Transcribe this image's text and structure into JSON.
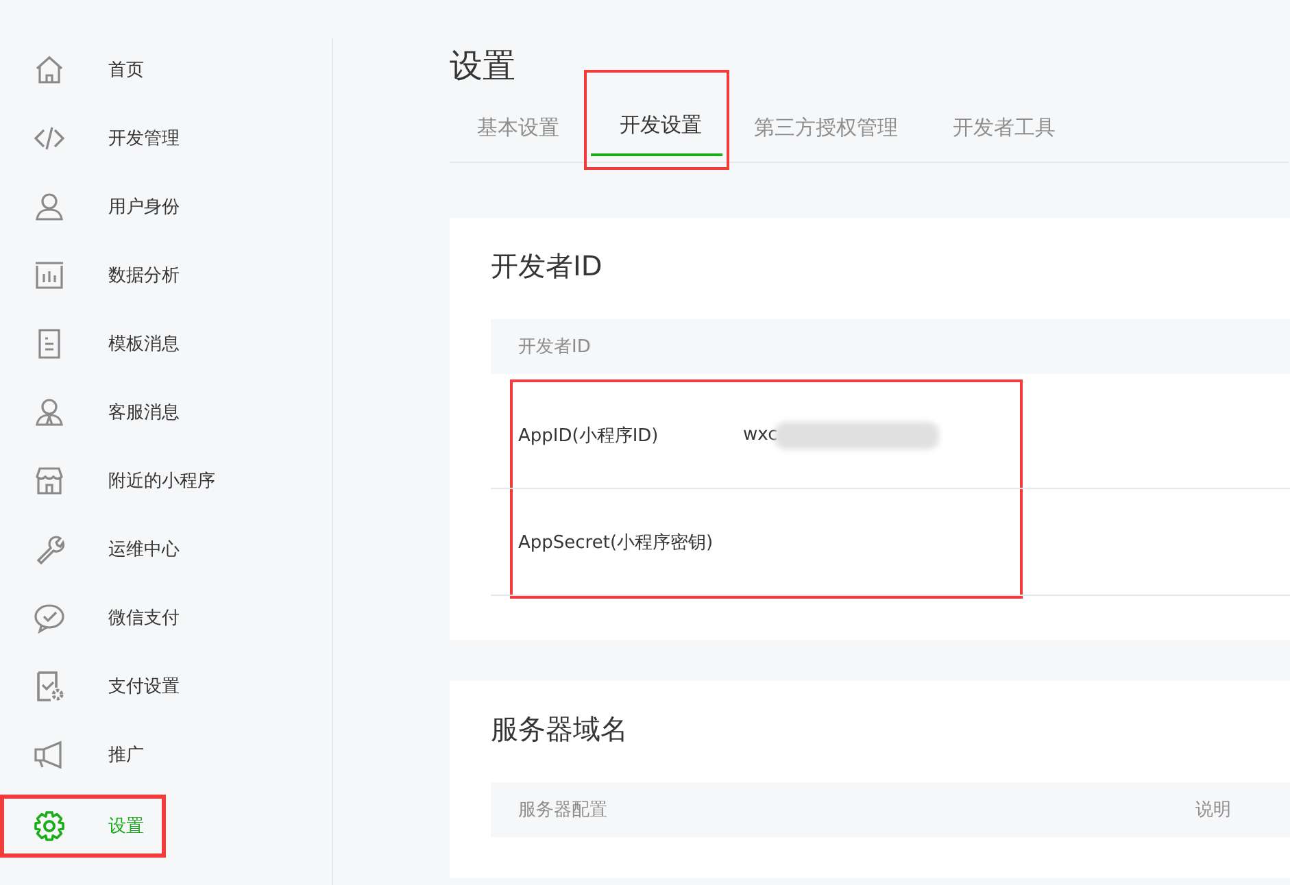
{
  "sidebar": {
    "items": [
      {
        "label": "首页",
        "selected": false,
        "highlighted": false
      },
      {
        "label": "开发管理",
        "selected": false,
        "highlighted": false
      },
      {
        "label": "用户身份",
        "selected": false,
        "highlighted": false
      },
      {
        "label": "数据分析",
        "selected": false,
        "highlighted": false
      },
      {
        "label": "模板消息",
        "selected": false,
        "highlighted": false
      },
      {
        "label": "客服消息",
        "selected": false,
        "highlighted": false
      },
      {
        "label": "附近的小程序",
        "selected": false,
        "highlighted": false
      },
      {
        "label": "运维中心",
        "selected": false,
        "highlighted": false
      },
      {
        "label": "微信支付",
        "selected": false,
        "highlighted": false
      },
      {
        "label": "支付设置",
        "selected": false,
        "highlighted": false
      },
      {
        "label": "推广",
        "selected": false,
        "highlighted": false
      },
      {
        "label": "设置",
        "selected": true,
        "highlighted": true
      }
    ]
  },
  "page_title": "设置",
  "tabs": [
    {
      "label": "基本设置",
      "selected": false,
      "highlighted": false
    },
    {
      "label": "开发设置",
      "selected": true,
      "highlighted": true
    },
    {
      "label": "第三方授权管理",
      "selected": false,
      "highlighted": false
    },
    {
      "label": "开发者工具",
      "selected": false,
      "highlighted": false
    }
  ],
  "developer_id": {
    "title": "开发者ID",
    "table": {
      "columns": [
        "开发者ID"
      ],
      "highlighted": true,
      "rows": [
        {
          "label": "AppID(小程序ID)",
          "value": "wxc",
          "redacted": true
        },
        {
          "label": "AppSecret(小程序密钥)",
          "redacted": false
        }
      ]
    }
  },
  "server_domain": {
    "title": "服务器域名",
    "table": {
      "columns": [
        "服务器配置",
        "说明"
      ]
    }
  }
}
